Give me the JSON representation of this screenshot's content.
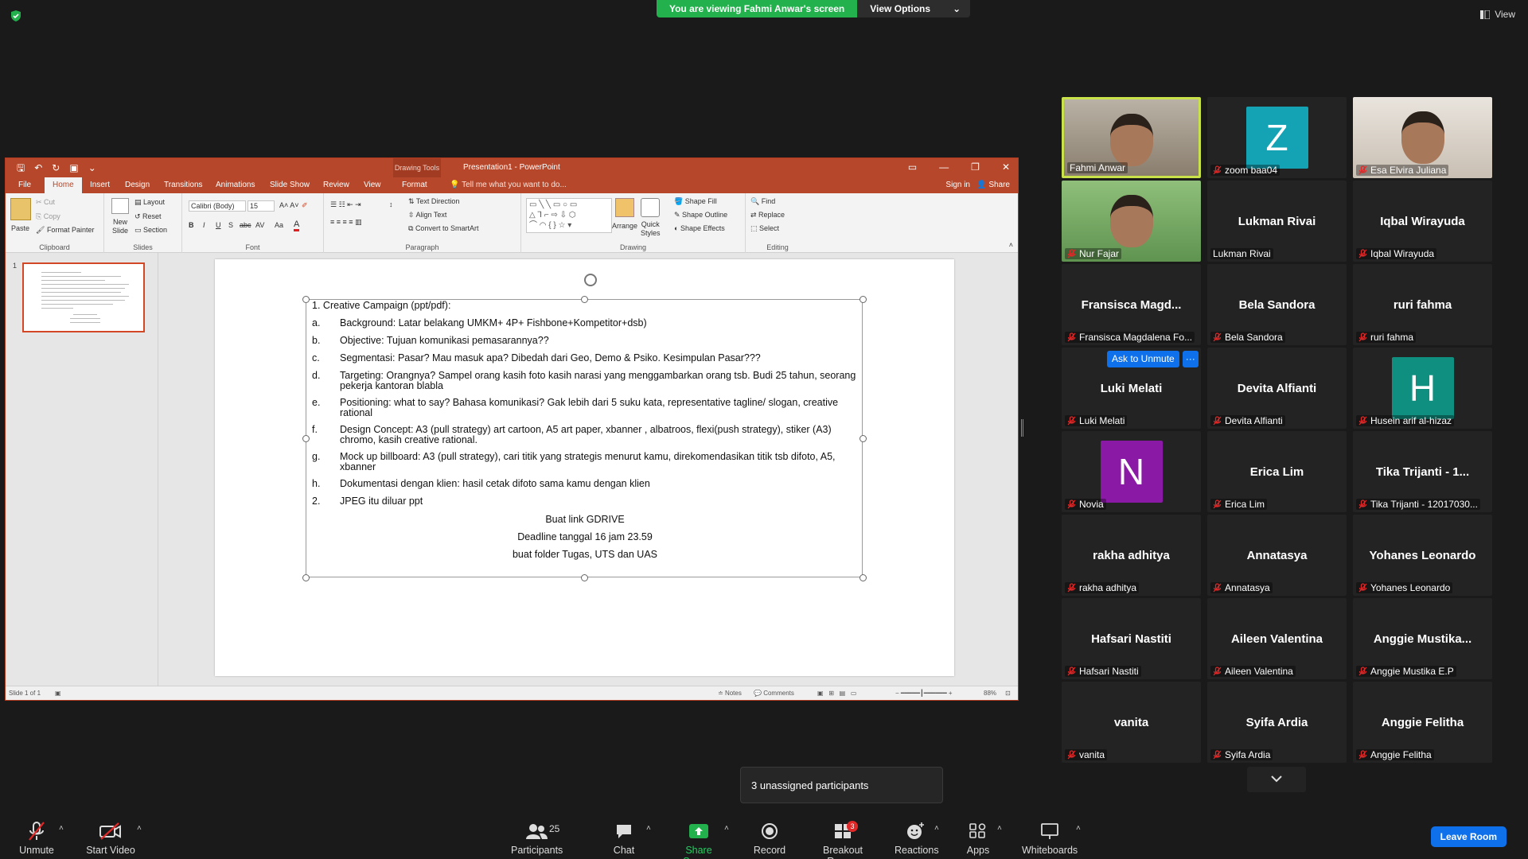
{
  "banner": {
    "viewing_text": "You are viewing Fahmi Anwar's screen",
    "view_options_label": "View Options",
    "view_label": "View"
  },
  "ppt": {
    "drawing_tools": "Drawing Tools",
    "title": "Presentation1 - PowerPoint",
    "tabs": [
      "File",
      "Home",
      "Insert",
      "Design",
      "Transitions",
      "Animations",
      "Slide Show",
      "Review",
      "View",
      "Format"
    ],
    "active_tab": "Home",
    "tell_me": "Tell me what you want to do...",
    "sign_in": "Sign in",
    "share": "Share",
    "ribbon": {
      "clipboard": {
        "label": "Clipboard",
        "paste": "Paste",
        "cut": "Cut",
        "copy": "Copy",
        "format_painter": "Format Painter"
      },
      "slides": {
        "label": "Slides",
        "new_slide": "New",
        "new_slide2": "Slide",
        "layout": "Layout",
        "reset": "Reset",
        "section": "Section"
      },
      "font": {
        "label": "Font",
        "font_name": "Calibri (Body)",
        "font_size": "15"
      },
      "paragraph": {
        "label": "Paragraph",
        "text_direction": "Text Direction",
        "align_text": "Align Text",
        "convert_smartart": "Convert to SmartArt"
      },
      "drawing": {
        "label": "Drawing",
        "arrange": "Arrange",
        "quick_styles": "Quick",
        "quick_styles2": "Styles",
        "shape_fill": "Shape Fill",
        "shape_outline": "Shape Outline",
        "shape_effects": "Shape Effects"
      },
      "editing": {
        "label": "Editing",
        "find": "Find",
        "replace": "Replace",
        "select": "Select"
      }
    },
    "thumb_number": "1",
    "slide": {
      "heading_num": "1.",
      "heading": "Creative Campaign (ppt/pdf):",
      "items": [
        {
          "n": "a.",
          "t": "Background: Latar belakang UMKM+ 4P+ Fishbone+Kompetitor+dsb)"
        },
        {
          "n": "b.",
          "t": "Objective: Tujuan komunikasi pemasarannya??"
        },
        {
          "n": "c.",
          "t": "Segmentasi: Pasar? Mau masuk apa? Dibedah dari Geo, Demo & Psiko. Kesimpulan Pasar???"
        },
        {
          "n": "d.",
          "t": "Targeting: Orangnya? Sampel orang kasih foto kasih narasi yang menggambarkan orang tsb. Budi 25 tahun, seorang pekerja kantoran blabla"
        },
        {
          "n": "e.",
          "t": "Positioning: what to say? Bahasa komunikasi? Gak lebih dari 5 suku kata, representative tagline/ slogan, creative rational"
        },
        {
          "n": "f.",
          "t": "Design Concept: A3 (pull strategy) art cartoon, A5 art paper, xbanner , albatroos, flexi(push strategy), stiker (A3) chromo, kasih creative rational."
        },
        {
          "n": "g.",
          "t": "Mock up billboard: A3 (pull strategy), cari titik yang strategis menurut kamu, direkomendasikan titik tsb difoto, A5, xbanner"
        },
        {
          "n": "h.",
          "t": "Dokumentasi dengan klien: hasil cetak difoto sama kamu dengan klien"
        },
        {
          "n": "2.",
          "t": "JPEG itu diluar ppt"
        }
      ],
      "center_lines": [
        "Buat link GDRIVE",
        "Deadline tanggal 16 jam 23.59",
        "buat folder Tugas, UTS dan UAS"
      ]
    },
    "status": {
      "slide_info": "Slide 1 of 1",
      "notes": "Notes",
      "comments": "Comments",
      "zoom": "88%"
    }
  },
  "participants": [
    {
      "display": "",
      "label": "Fahmi Anwar",
      "muted": false,
      "kind": "video",
      "active": true
    },
    {
      "display": "Z",
      "label": "zoom baa04",
      "muted": true,
      "kind": "avatar",
      "color": "#13a3b5"
    },
    {
      "display": "",
      "label": "Esa Elvira Juliana",
      "muted": true,
      "kind": "video"
    },
    {
      "display": "",
      "label": "Nur Fajar",
      "muted": true,
      "kind": "video"
    },
    {
      "display": "Lukman Rivai",
      "label": "Lukman Rivai",
      "muted": false,
      "kind": "name"
    },
    {
      "display": "Iqbal Wirayuda",
      "label": "Iqbal Wirayuda",
      "muted": true,
      "kind": "name"
    },
    {
      "display": "Fransisca  Magd...",
      "label": "Fransisca Magdalena Fo...",
      "muted": true,
      "kind": "name"
    },
    {
      "display": "Bela Sandora",
      "label": "Bela Sandora",
      "muted": true,
      "kind": "name"
    },
    {
      "display": "ruri fahma",
      "label": "ruri fahma",
      "muted": true,
      "kind": "name"
    },
    {
      "display": "Luki Melati",
      "label": "Luki Melati",
      "muted": true,
      "kind": "name"
    },
    {
      "display": "Devita Alfianti",
      "label": "Devita Alfianti",
      "muted": true,
      "kind": "name"
    },
    {
      "display": "H",
      "label": "Husein arif al-hizaz",
      "muted": true,
      "kind": "avatar",
      "color": "#0f8f80"
    },
    {
      "display": "N",
      "label": "Novia",
      "muted": true,
      "kind": "avatar",
      "color": "#8a1aa6"
    },
    {
      "display": "Erica Lim",
      "label": "Erica Lim",
      "muted": true,
      "kind": "name"
    },
    {
      "display": "Tika Trijanti  - 1...",
      "label": "Tika Trijanti  - 12017030...",
      "muted": true,
      "kind": "name"
    },
    {
      "display": "rakha adhitya",
      "label": "rakha adhitya",
      "muted": true,
      "kind": "name"
    },
    {
      "display": "Annatasya",
      "label": "Annatasya",
      "muted": true,
      "kind": "name"
    },
    {
      "display": "Yohanes Leonardo",
      "label": "Yohanes Leonardo",
      "muted": true,
      "kind": "name"
    },
    {
      "display": "Hafsari Nastiti",
      "label": "Hafsari Nastiti",
      "muted": true,
      "kind": "name"
    },
    {
      "display": "Aileen Valentina",
      "label": "Aileen Valentina",
      "muted": true,
      "kind": "name"
    },
    {
      "display": "Anggie  Mustika...",
      "label": "Anggie Mustika E.P",
      "muted": true,
      "kind": "name"
    },
    {
      "display": "vanita",
      "label": "vanita",
      "muted": true,
      "kind": "name"
    },
    {
      "display": "Syifa Ardia",
      "label": "Syifa Ardia",
      "muted": true,
      "kind": "name"
    },
    {
      "display": "Anggie Felitha",
      "label": "Anggie Felitha",
      "muted": true,
      "kind": "name"
    }
  ],
  "ask_to_unmute": "Ask to Unmute",
  "more": "···",
  "toast": "3 unassigned participants",
  "toolbar": {
    "unmute": "Unmute",
    "start_video": "Start Video",
    "participants": "Participants",
    "participant_count": "25",
    "chat": "Chat",
    "share_screen": "Share Screen",
    "record": "Record",
    "breakout_rooms": "Breakout Rooms",
    "breakout_badge": "3",
    "reactions": "Reactions",
    "apps": "Apps",
    "whiteboards": "Whiteboards",
    "leave": "Leave Room"
  }
}
